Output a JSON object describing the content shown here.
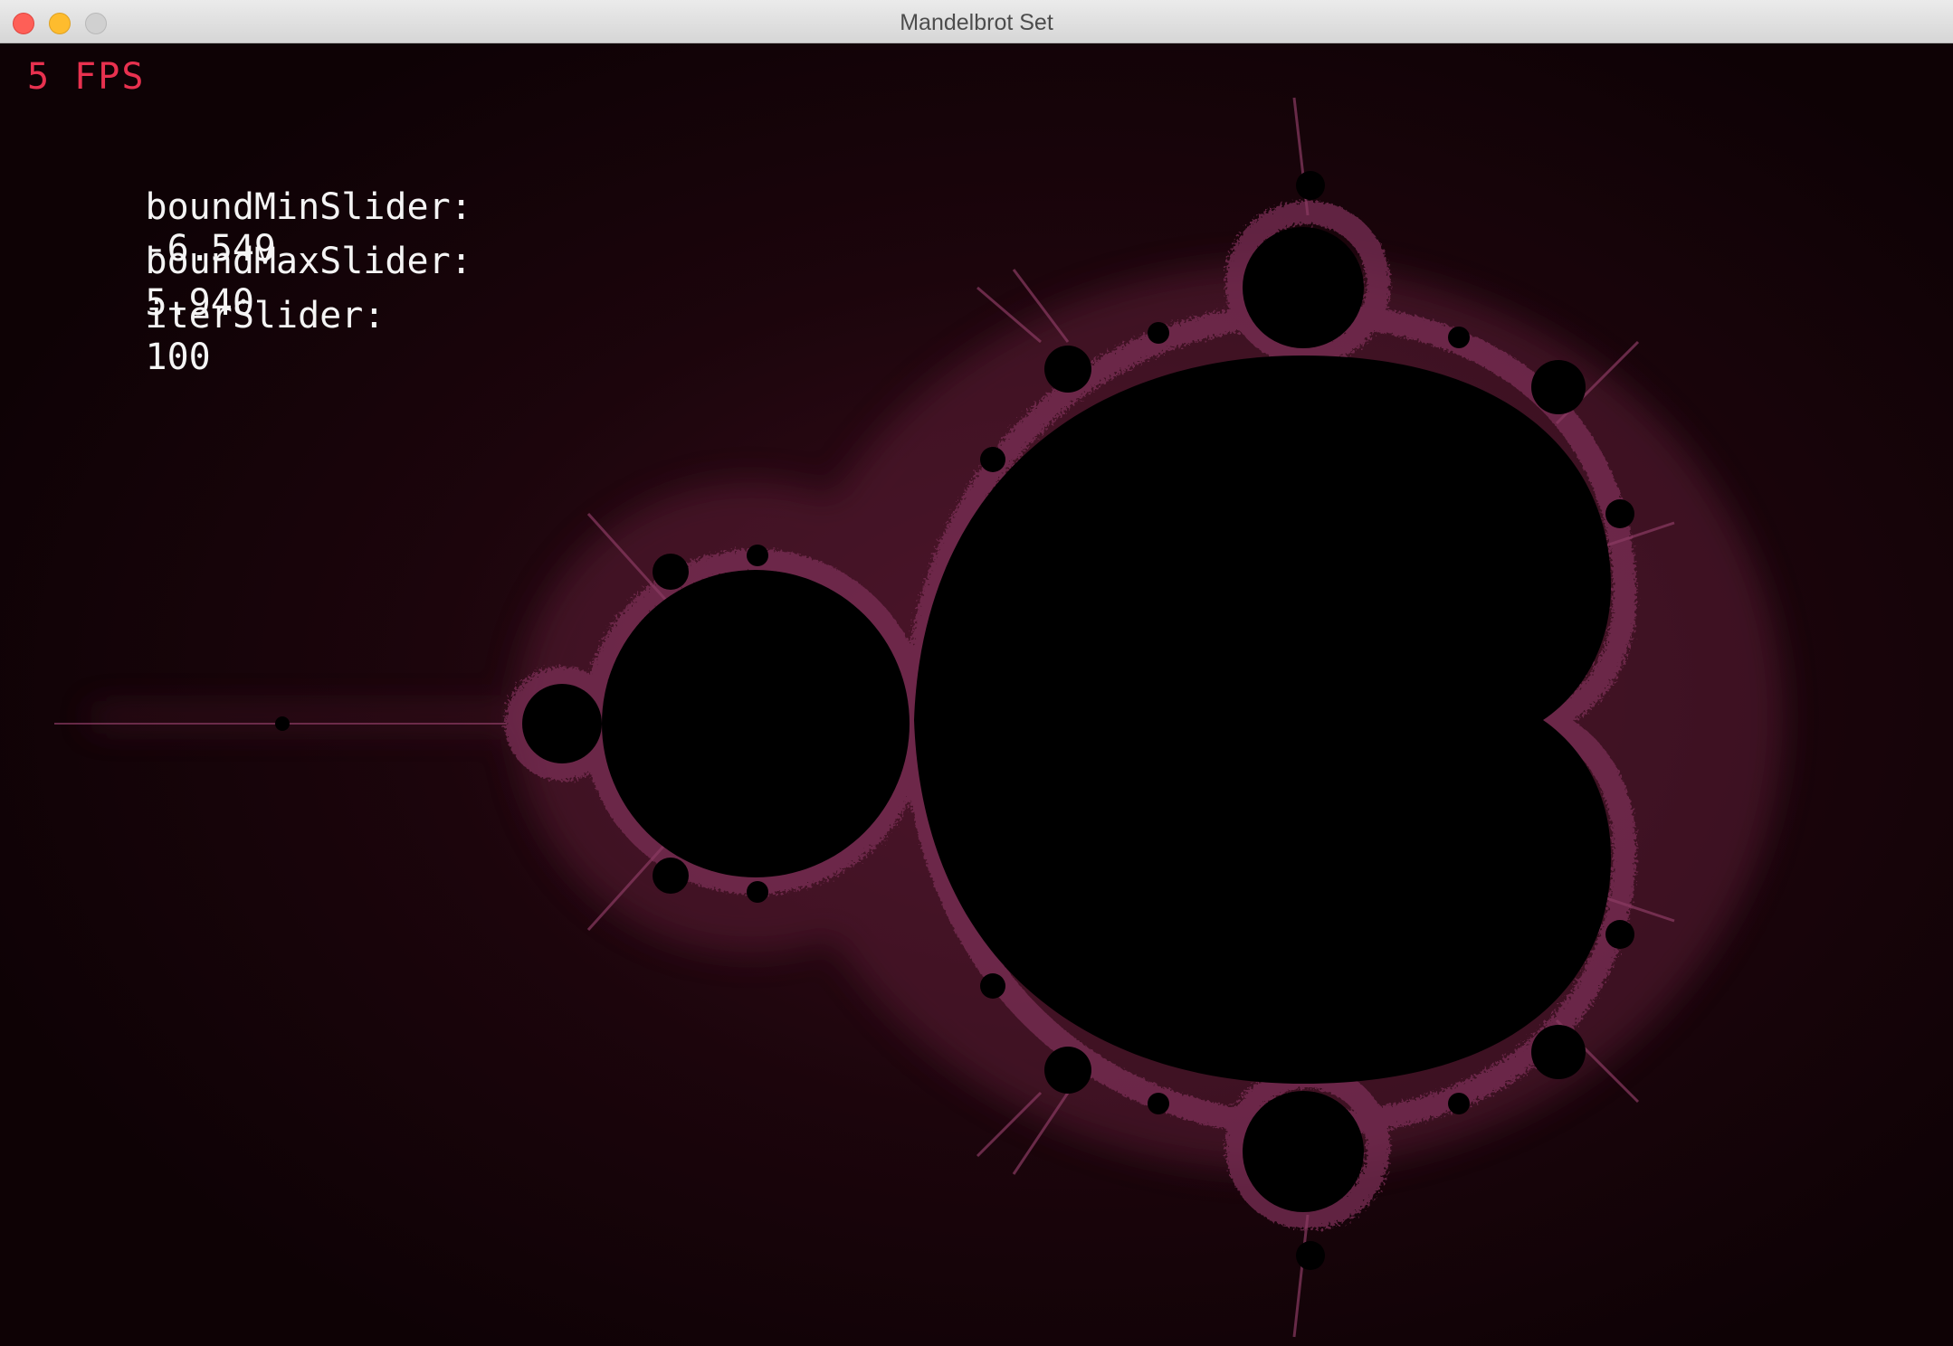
{
  "window": {
    "title": "Mandelbrot Set"
  },
  "hud": {
    "fps": "5 FPS",
    "sliders": [
      {
        "label": "boundMinSlider:",
        "value": "-6.549"
      },
      {
        "label": "boundMaxSlider:",
        "value": "5.940"
      },
      {
        "label": "iterSlider:",
        "value": "100"
      }
    ]
  },
  "colors": {
    "fps_text": "#e8314f",
    "hud_text": "#f4f4f4",
    "background": "#120206",
    "fractal_glow": "#7a2e55",
    "set_interior": "#000000"
  }
}
